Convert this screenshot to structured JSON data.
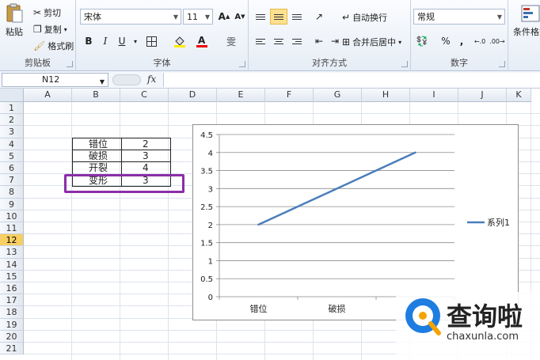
{
  "ribbon": {
    "clipboard": {
      "paste": "粘贴",
      "cut": "剪切",
      "copy": "复制",
      "format_painter": "格式刷",
      "label": "剪贴板"
    },
    "font": {
      "font_name": "宋体",
      "font_size": "11",
      "bold": "B",
      "italic": "I",
      "underline": "U",
      "grow": "A",
      "shrink": "A",
      "font_color_letter": "A",
      "label": "字体"
    },
    "alignment": {
      "wrap_text": "自动换行",
      "merge_center": "合并后居中",
      "label": "对齐方式"
    },
    "number": {
      "format": "常规",
      "percent": "%",
      "comma": ",",
      "label": "数字"
    },
    "styles": {
      "conditional_format": "条件格式"
    }
  },
  "formula_bar": {
    "name_box": "N12",
    "fx": "fx",
    "formula": ""
  },
  "grid": {
    "columns": [
      "A",
      "B",
      "C",
      "D",
      "E",
      "F",
      "G",
      "H",
      "I",
      "J",
      "K"
    ],
    "rows": [
      "1",
      "2",
      "3",
      "4",
      "5",
      "6",
      "7",
      "8",
      "9",
      "10",
      "11",
      "12",
      "13",
      "14",
      "15",
      "16",
      "17",
      "18",
      "19",
      "20",
      "21"
    ],
    "selected_row": "12",
    "table": [
      {
        "label": "错位",
        "value": "2"
      },
      {
        "label": "破损",
        "value": "3"
      },
      {
        "label": "开裂",
        "value": "4"
      },
      {
        "label": "变形",
        "value": "3"
      }
    ]
  },
  "chart_data": {
    "type": "line",
    "categories": [
      "错位",
      "破损"
    ],
    "series": [
      {
        "name": "系列1",
        "values": [
          2,
          3,
          4
        ]
      }
    ],
    "ylim": [
      0,
      4.5
    ],
    "yticks": [
      "0",
      "0.5",
      "1",
      "1.5",
      "2",
      "2.5",
      "3",
      "3.5",
      "4",
      "4.5"
    ],
    "grid": true,
    "legend": "right",
    "line_color": "#4a7ebb"
  },
  "watermark": {
    "title": "查询啦",
    "url": "chaxunla.com"
  }
}
